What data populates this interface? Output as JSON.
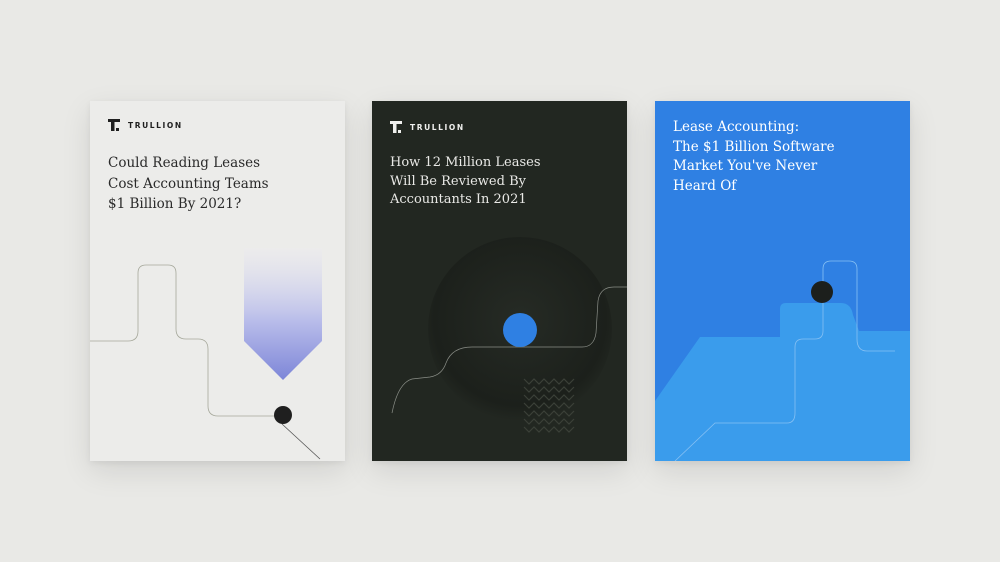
{
  "covers": [
    {
      "brand": "TRULLION",
      "logo_icon": "trullion-logo-icon",
      "title": "Could Reading Leases\nCost Accounting Teams\n$1 Billion By 2021?",
      "background": "#ececea"
    },
    {
      "brand": "TRULLION",
      "logo_icon": "trullion-logo-icon",
      "title": "How 12 Million Leases\nWill Be Reviewed By\nAccountants In 2021",
      "background": "#222721",
      "accent": "#2f80e3"
    },
    {
      "title": "Lease Accounting:\nThe $1 Billion Software\nMarket You've Never\nHeard Of",
      "background": "#2f80e3",
      "accent": "#3aa0ee"
    }
  ]
}
